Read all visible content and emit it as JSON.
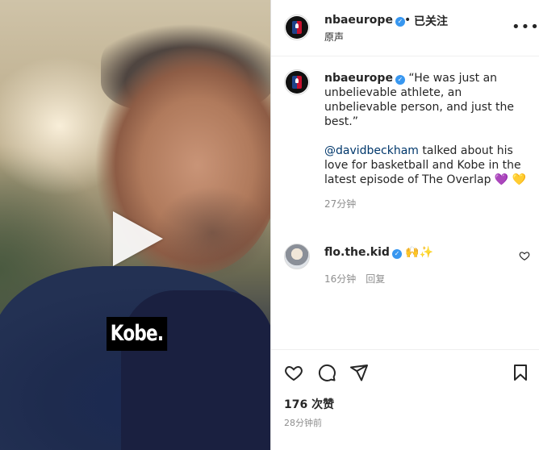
{
  "media": {
    "caption_overlay": "Kobe."
  },
  "post_header": {
    "username": "nbaeurope",
    "verified_mark": "✓",
    "separator": "•",
    "follow_state": "已关注",
    "audio_label": "原声",
    "more_icon": "more-horizontal-icon",
    "more_label": "•••"
  },
  "caption": {
    "username": "nbaeurope",
    "text_part1": " “He was just an unbelievable athlete, an unbelievable person, and just the best.”",
    "mention": "@davidbeckham",
    "text_part2": " talked about his love for basketball and Kobe in the latest episode of The Overlap ",
    "emoji_purple_heart": "💜",
    "emoji_yellow_heart": "💛",
    "time_ago": "27分钟"
  },
  "comments": [
    {
      "username": "flo.the.kid",
      "text": " 🙌✨",
      "time_ago": "16分钟",
      "reply_label": "回复"
    }
  ],
  "actions": {
    "like_icon": "heart-icon",
    "comment_icon": "comment-icon",
    "share_icon": "send-icon",
    "save_icon": "bookmark-icon"
  },
  "likes_text": "176 次赞",
  "posted_ago": "28分钟前",
  "colors": {
    "verified": "#3897f0",
    "mention": "#00376b",
    "secondary_text": "#8e8e8e",
    "border": "#dbdbdb"
  }
}
